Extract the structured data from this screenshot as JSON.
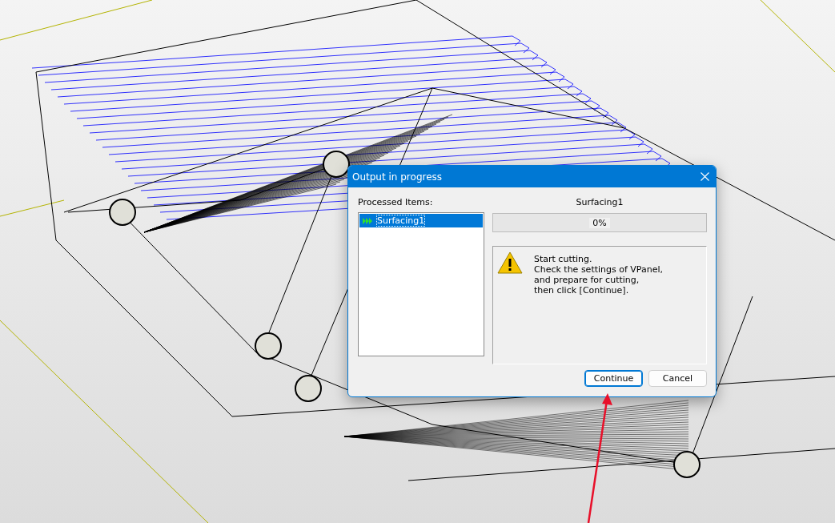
{
  "dialog": {
    "title": "Output in progress",
    "list_label": "Processed Items:",
    "items": [
      {
        "label": "Surfacing1",
        "selected": true
      }
    ],
    "current_item": "Surfacing1",
    "progress": {
      "level": 0,
      "reading": "0%"
    },
    "message_lines": [
      "Start cutting.",
      "Check the settings of VPanel,",
      "and prepare for cutting,",
      "then click [Continue]."
    ],
    "buttons": [
      {
        "label": "Continue",
        "default": true
      },
      {
        "label": "Cancel",
        "default": false
      }
    ]
  }
}
